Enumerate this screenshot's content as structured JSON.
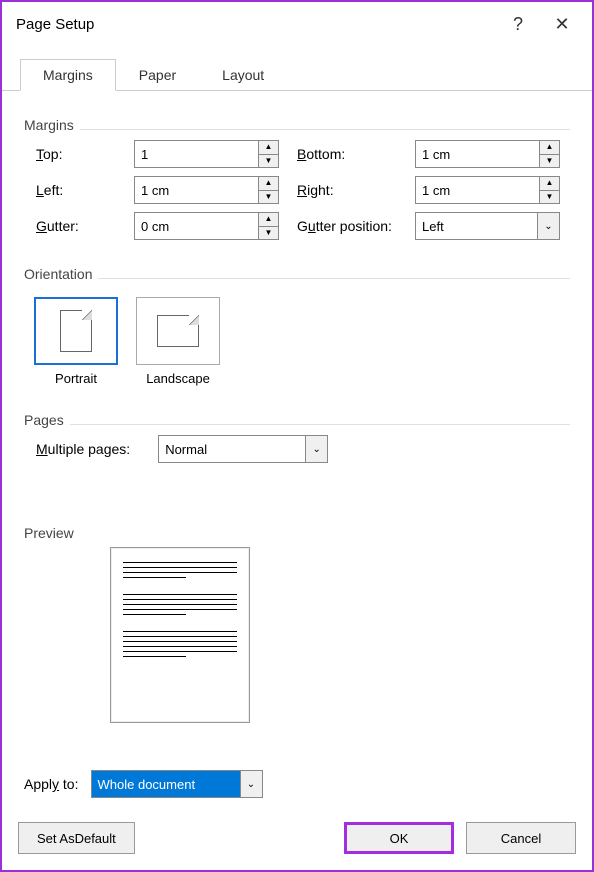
{
  "window": {
    "title": "Page Setup",
    "help_label": "?",
    "close_label": "✕"
  },
  "tabs": [
    {
      "label": "Margins",
      "active": true
    },
    {
      "label": "Paper",
      "active": false
    },
    {
      "label": "Layout",
      "active": false
    }
  ],
  "sections": {
    "margins": {
      "title": "Margins"
    },
    "orientation": {
      "title": "Orientation"
    },
    "pages": {
      "title": "Pages"
    },
    "preview": {
      "title": "Preview"
    }
  },
  "margins": {
    "top": {
      "label": "Top:",
      "underline": "T",
      "value": "1"
    },
    "bottom": {
      "label": "Bottom:",
      "underline": "B",
      "value": "1 cm"
    },
    "left": {
      "label": "Left:",
      "underline": "L",
      "value": "1 cm"
    },
    "right": {
      "label": "Right:",
      "underline": "R",
      "value": "1 cm"
    },
    "gutter": {
      "label": "Gutter:",
      "underline": "G",
      "value": "0 cm"
    },
    "gutter_position": {
      "label": "Gutter position:",
      "underline": "u",
      "value": "Left"
    }
  },
  "orientation": {
    "portrait": {
      "label": "Portrait",
      "underline": "P",
      "selected": true
    },
    "landscape": {
      "label": "Landscape",
      "underline": "s",
      "selected": false
    }
  },
  "pages": {
    "multiple_label": "Multiple pages:",
    "multiple_underline": "M",
    "multiple_value": "Normal"
  },
  "apply_to": {
    "label": "Apply to:",
    "underline": "y",
    "value": "Whole document",
    "highlighted": true
  },
  "footer": {
    "set_default": "Set As Default",
    "set_default_underline": "D",
    "ok": "OK",
    "cancel": "Cancel"
  }
}
